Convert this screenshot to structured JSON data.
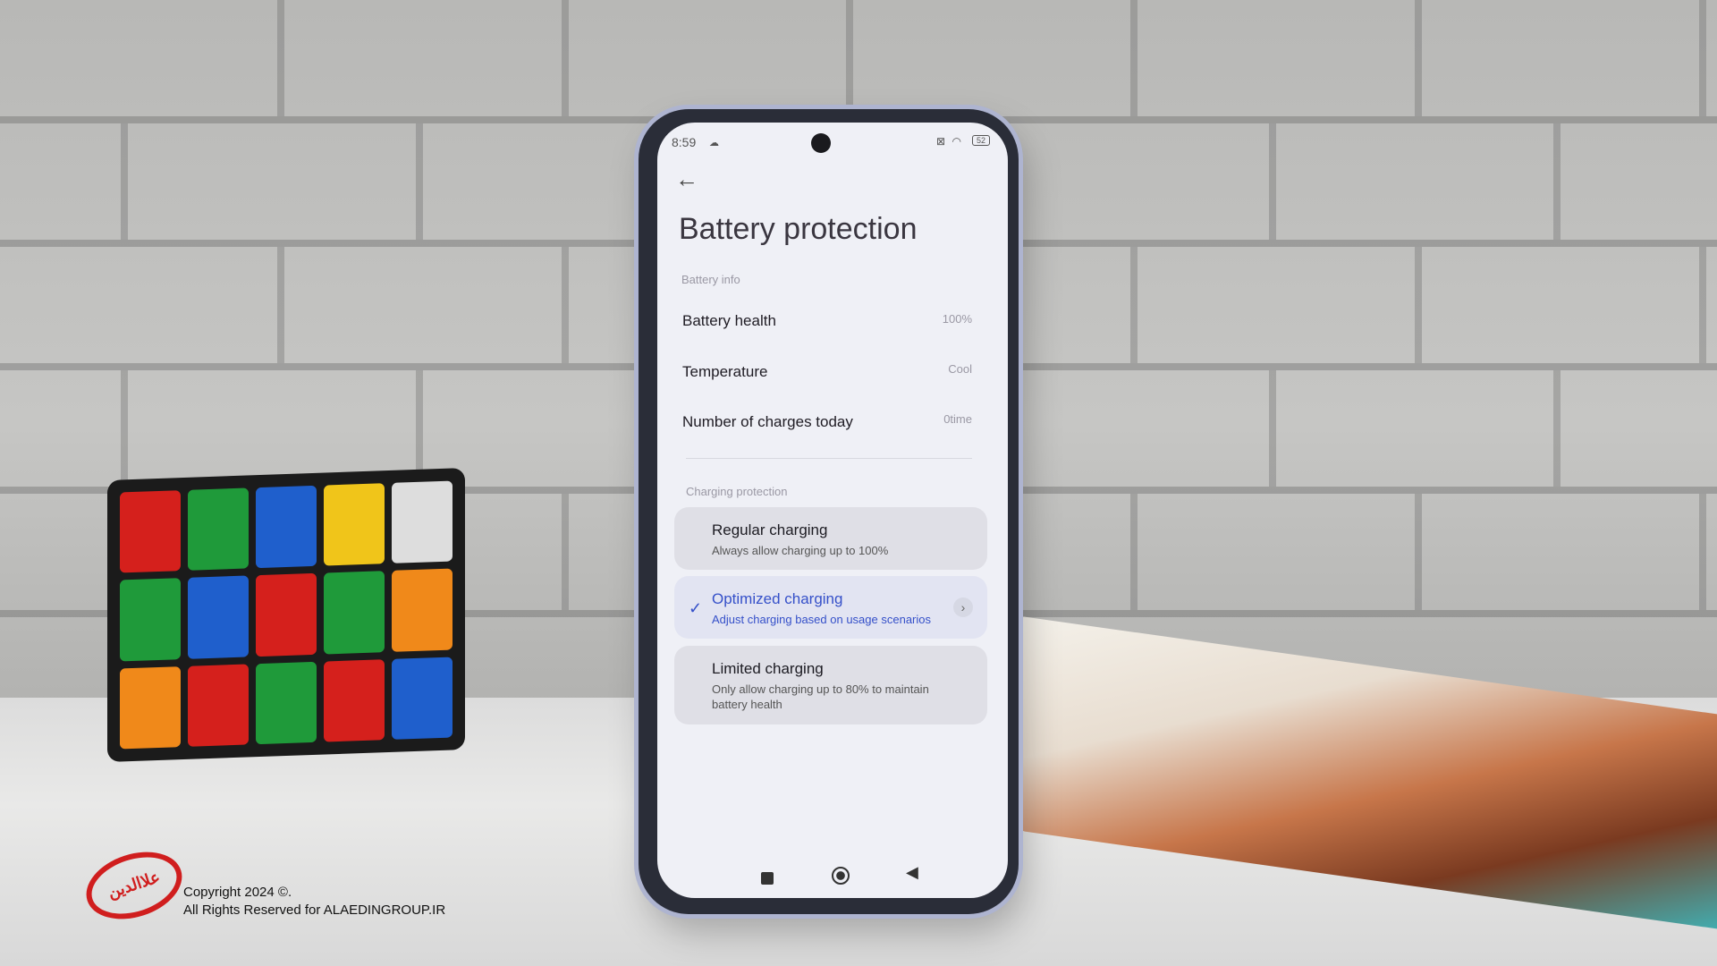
{
  "status_bar": {
    "time": "8:59",
    "cloud_icon": "cloud-icon",
    "battery_level": "52",
    "icons": [
      "sim-off-icon",
      "wifi-icon",
      "battery-icon"
    ]
  },
  "header": {
    "back_icon": "arrow-left-icon",
    "title": "Battery protection"
  },
  "battery_info": {
    "section_label": "Battery info",
    "rows": [
      {
        "label": "Battery health",
        "value": "100%"
      },
      {
        "label": "Temperature",
        "value": "Cool"
      },
      {
        "label": "Number of charges today",
        "value": "0time"
      }
    ]
  },
  "charging_protection": {
    "section_label": "Charging protection",
    "options": [
      {
        "title": "Regular charging",
        "subtitle": "Always allow charging up to 100%",
        "selected": false
      },
      {
        "title": "Optimized charging",
        "subtitle": "Adjust charging based on usage scenarios",
        "selected": true
      },
      {
        "title": "Limited charging",
        "subtitle": "Only allow charging up to 80% to maintain battery health",
        "selected": false
      }
    ],
    "accent_color": "#3550c9"
  },
  "nav_bar": {
    "icons": [
      "recents-square-icon",
      "home-circle-icon",
      "back-triangle-icon"
    ]
  },
  "watermark": {
    "logo_text": "علاالدین",
    "line1": "Copyright 2024 ©.",
    "line2": "All Rights Reserved for ALAEDINGROUP.IR"
  }
}
